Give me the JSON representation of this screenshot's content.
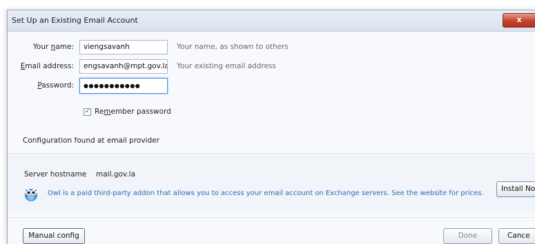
{
  "window": {
    "title": "Set Up an Existing Email Account",
    "close_label": "x"
  },
  "form": {
    "name": {
      "label_pre": "Your ",
      "label_accel": "n",
      "label_post": "ame:",
      "value": "viengsavanh",
      "hint": "Your name, as shown to others"
    },
    "email": {
      "label_pre": "",
      "label_accel": "E",
      "label_post": "mail address:",
      "value": "engsavanh@mpt.gov.la",
      "hint": "Your existing email address"
    },
    "password": {
      "label_pre": "",
      "label_accel": "P",
      "label_post": "assword:",
      "value": "●●●●●●●●●●●"
    },
    "remember": {
      "label_pre": "Re",
      "label_accel": "m",
      "label_post": "ember password",
      "checked": true,
      "check_glyph": "✓"
    }
  },
  "config": {
    "status": "Configuration found at email provider",
    "server_label": "Server hostname",
    "server_value": "mail.gov.la"
  },
  "addon": {
    "text": "Owl is a paid third-party addon that allows you to access your email account on Exchange servers. See the website for prices.",
    "install_label": "Install No",
    "icon": "owl-icon"
  },
  "buttons": {
    "manual_config": "Manual config",
    "done": "Done",
    "cancel": "Cance"
  },
  "colors": {
    "accent_link": "#2a6bb8",
    "close_red": "#c4422f"
  }
}
